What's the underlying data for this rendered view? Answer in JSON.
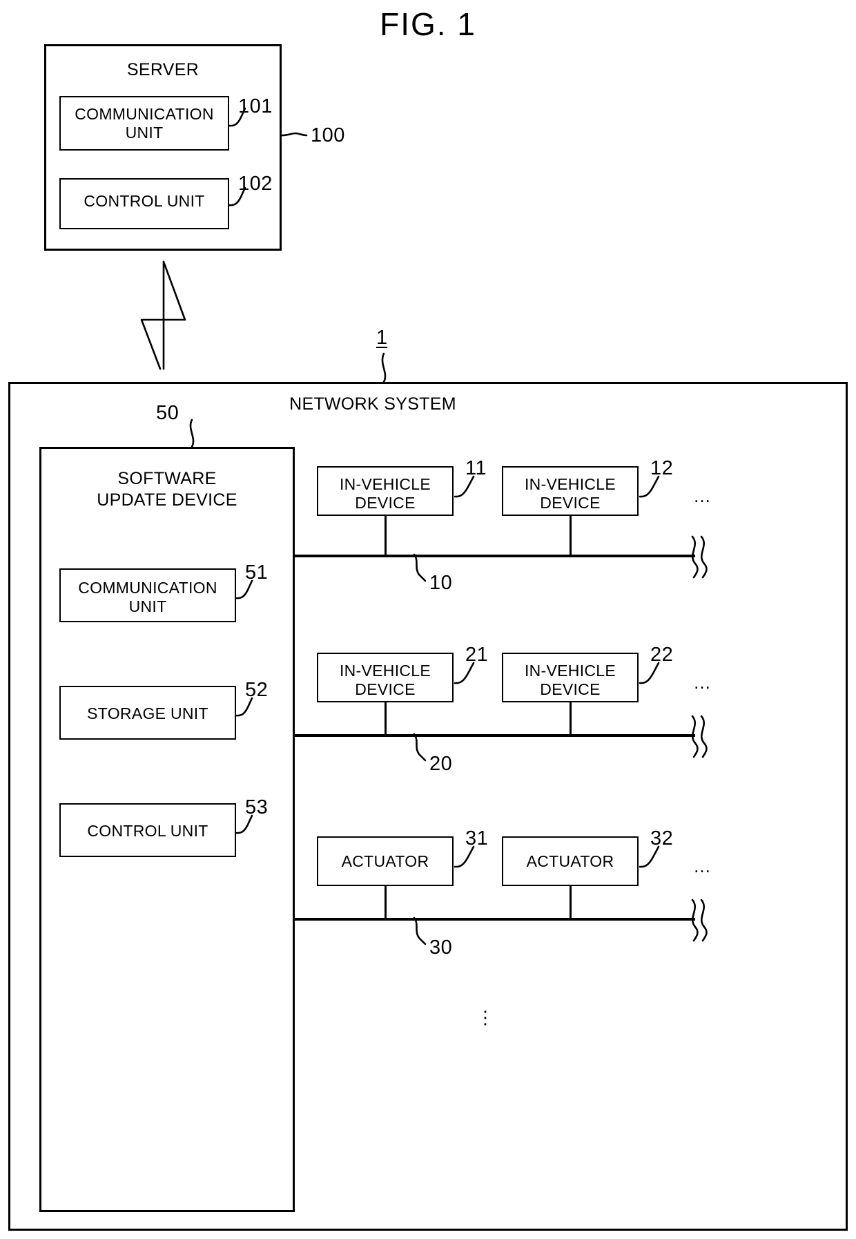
{
  "figure": {
    "title": "FIG. 1"
  },
  "server": {
    "title": "SERVER",
    "ref": "100",
    "units": [
      {
        "label": "COMMUNICATION\nUNIT",
        "ref": "101"
      },
      {
        "label": "CONTROL UNIT",
        "ref": "102"
      }
    ]
  },
  "network_system": {
    "title": "NETWORK SYSTEM",
    "ref": "1",
    "software_update_device": {
      "title": "SOFTWARE\nUPDATE DEVICE",
      "ref": "50",
      "units": [
        {
          "label": "COMMUNICATION\nUNIT",
          "ref": "51"
        },
        {
          "label": "STORAGE UNIT",
          "ref": "52"
        },
        {
          "label": "CONTROL UNIT",
          "ref": "53"
        }
      ]
    },
    "buses": [
      {
        "ref": "10",
        "continuation": "…",
        "nodes": [
          {
            "label": "IN-VEHICLE\nDEVICE",
            "ref": "11"
          },
          {
            "label": "IN-VEHICLE\nDEVICE",
            "ref": "12"
          }
        ]
      },
      {
        "ref": "20",
        "continuation": "…",
        "nodes": [
          {
            "label": "IN-VEHICLE\nDEVICE",
            "ref": "21"
          },
          {
            "label": "IN-VEHICLE\nDEVICE",
            "ref": "22"
          }
        ]
      },
      {
        "ref": "30",
        "continuation": "…",
        "nodes": [
          {
            "label": "ACTUATOR",
            "ref": "31"
          },
          {
            "label": "ACTUATOR",
            "ref": "32"
          }
        ]
      }
    ],
    "more_buses_indicator": "⋮"
  },
  "wireless_link": {
    "name": "wireless-lightning-symbol"
  }
}
